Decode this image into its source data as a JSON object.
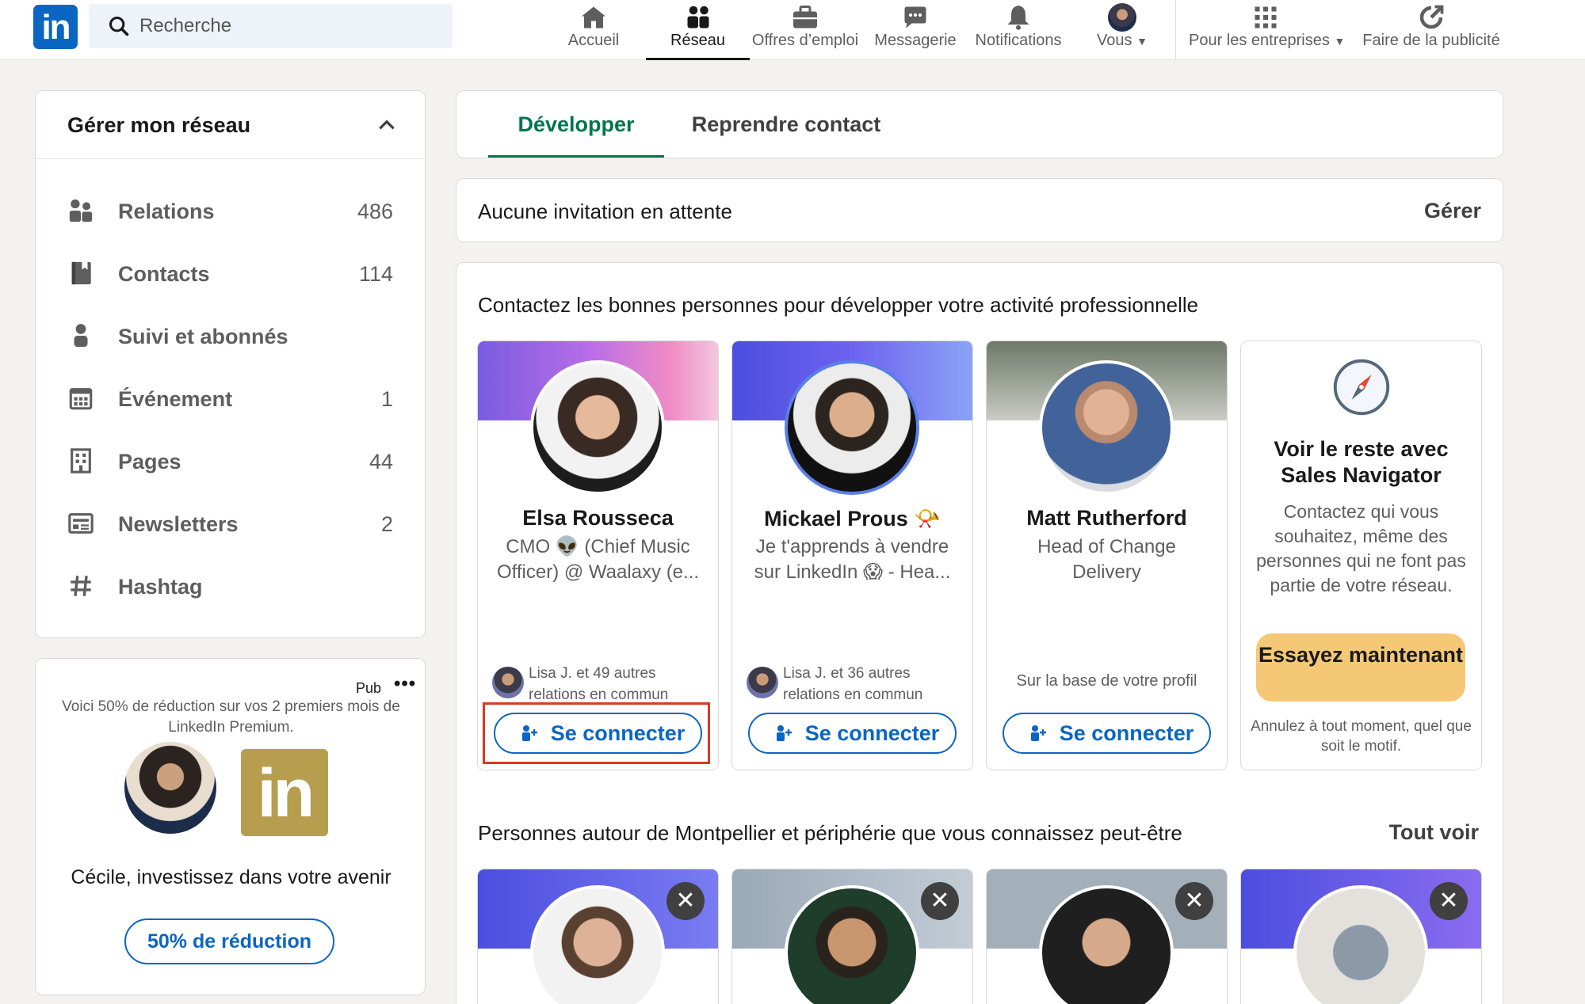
{
  "nav": {
    "search_placeholder": "Recherche",
    "items": [
      {
        "label": "Accueil",
        "icon": "home-icon"
      },
      {
        "label": "Réseau",
        "icon": "network-icon",
        "active": true
      },
      {
        "label": "Offres d’emploi",
        "icon": "briefcase-icon"
      },
      {
        "label": "Messagerie",
        "icon": "chat-icon"
      },
      {
        "label": "Notifications",
        "icon": "bell-icon"
      },
      {
        "label": "Vous",
        "icon": "avatar"
      },
      {
        "label": "Pour les entreprises",
        "icon": "grid-icon"
      },
      {
        "label": "Faire de la publicité",
        "icon": "ad-icon"
      }
    ]
  },
  "sidebar": {
    "title": "Gérer mon réseau",
    "items": [
      {
        "label": "Relations",
        "count": "486",
        "icon": "people-icon"
      },
      {
        "label": "Contacts",
        "count": "114",
        "icon": "contact-book-icon"
      },
      {
        "label": "Suivi et abonnés",
        "count": "",
        "icon": "person-icon"
      },
      {
        "label": "Événement",
        "count": "1",
        "icon": "calendar-icon"
      },
      {
        "label": "Pages",
        "count": "44",
        "icon": "building-icon"
      },
      {
        "label": "Newsletters",
        "count": "2",
        "icon": "newsletter-icon"
      },
      {
        "label": "Hashtag",
        "count": "",
        "icon": "hashtag-icon"
      }
    ]
  },
  "ad": {
    "pub": "Pub",
    "more": "•••",
    "description": "Voici 50% de réduction sur vos 2 premiers mois de LinkedIn Premium.",
    "logo_text": "in",
    "pitch": "Cécile, investissez dans votre avenir",
    "cta": "50% de réduction"
  },
  "tabs": {
    "develop": "Développer",
    "reconnect": "Reprendre contact"
  },
  "invitations": {
    "message": "Aucune invitation en attente",
    "manage": "Gérer"
  },
  "suggestions": {
    "heading": "Contactez les bonnes personnes pour développer votre activité professionnelle",
    "connect_label": "Se connecter",
    "people": [
      {
        "name": "Elsa Rousseca",
        "title": "CMO 👽 (Chief Music Officer) @ Waalaxy (e...",
        "mutual": "Lisa J. et 49 autres relations en commun"
      },
      {
        "name": "Mickael Prous 📯",
        "title": "Je t'apprends à vendre sur LinkedIn 😱 - Hea...",
        "mutual": "Lisa J. et 36 autres relations en commun"
      },
      {
        "name": "Matt Rutherford",
        "title": "Head of Change Delivery",
        "basis": "Sur la base de votre profil"
      }
    ],
    "navigator": {
      "title": "Voir le reste avec Sales Navigator",
      "description": "Contactez qui vous souhaitez, même des personnes qui ne font pas partie de votre réseau.",
      "cta": "Essayez maintenant",
      "fine_print": "Annulez à tout moment, quel que soit le motif."
    }
  },
  "nearby": {
    "heading": "Personnes autour de Montpellier et périphérie que vous connaissez peut-être",
    "see_all": "Tout voir",
    "dismiss": "✕"
  },
  "colors": {
    "brand": "#0a66c2",
    "active_tab": "#01754f",
    "highlight": "#d93a24",
    "premium_cta": "#f5c875"
  }
}
